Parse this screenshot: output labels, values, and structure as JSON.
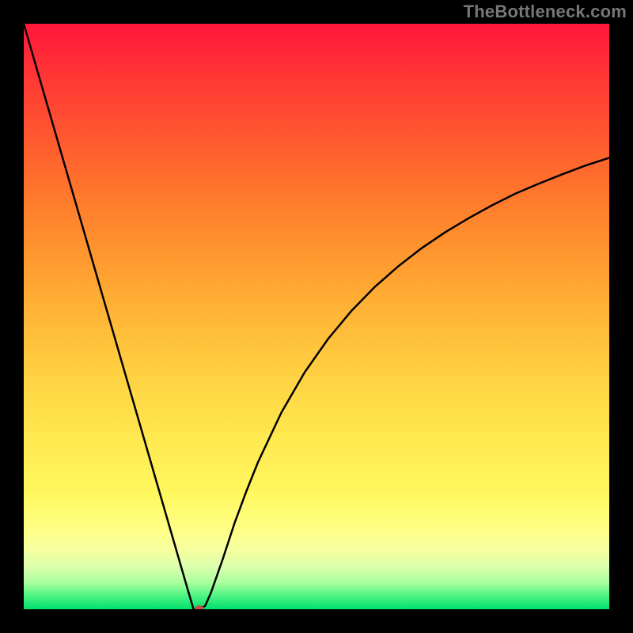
{
  "attribution": "TheBottleneck.com",
  "colors": {
    "page_bg": "#000000",
    "curve_stroke": "#000000",
    "marker_fill": "#c05048"
  },
  "gradient_stops": [
    {
      "offset": 0.0,
      "color": "#ff173a"
    },
    {
      "offset": 0.1,
      "color": "#ff3a34"
    },
    {
      "offset": 0.2,
      "color": "#ff5a2f"
    },
    {
      "offset": 0.3,
      "color": "#ff7a2c"
    },
    {
      "offset": 0.4,
      "color": "#ff992f"
    },
    {
      "offset": 0.5,
      "color": "#ffb637"
    },
    {
      "offset": 0.6,
      "color": "#ffd142"
    },
    {
      "offset": 0.7,
      "color": "#ffe74f"
    },
    {
      "offset": 0.8,
      "color": "#fff75e"
    },
    {
      "offset": 0.86,
      "color": "#ffff84"
    },
    {
      "offset": 0.9,
      "color": "#f4ffa0"
    },
    {
      "offset": 0.93,
      "color": "#d8ffac"
    },
    {
      "offset": 0.955,
      "color": "#a8ff9d"
    },
    {
      "offset": 0.975,
      "color": "#55f584"
    },
    {
      "offset": 1.0,
      "color": "#00e06f"
    }
  ],
  "chart_data": {
    "type": "line",
    "title": "",
    "xlabel": "",
    "ylabel": "",
    "xlim": [
      0,
      100
    ],
    "ylim": [
      0,
      100
    ],
    "x": [
      0,
      2,
      4,
      6,
      8,
      10,
      12,
      14,
      16,
      18,
      20,
      22,
      24,
      26,
      28,
      29,
      30,
      31,
      32,
      34,
      36,
      38,
      40,
      44,
      48,
      52,
      56,
      60,
      64,
      68,
      72,
      76,
      80,
      84,
      88,
      92,
      96,
      100
    ],
    "values": [
      100,
      93.1,
      86.2,
      79.3,
      72.4,
      65.5,
      58.6,
      51.7,
      44.8,
      37.9,
      31.0,
      24.1,
      17.2,
      10.3,
      3.4,
      0.0,
      0.0,
      0.6,
      2.9,
      8.6,
      14.7,
      20.1,
      25.1,
      33.6,
      40.5,
      46.2,
      51.0,
      55.1,
      58.6,
      61.7,
      64.4,
      66.8,
      69.0,
      71.0,
      72.7,
      74.3,
      75.8,
      77.1
    ],
    "marker": {
      "x": 30,
      "y": 0
    }
  }
}
